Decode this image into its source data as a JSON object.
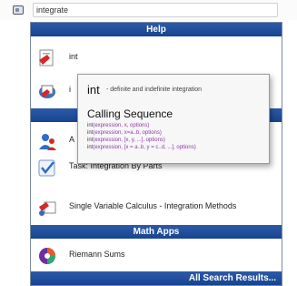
{
  "search": {
    "value": "integrate"
  },
  "sections": {
    "help": "Help",
    "math_apps": "Math Apps"
  },
  "results": [
    {
      "label": "int",
      "icon": "help-page-icon"
    },
    {
      "label": "i",
      "icon": "help-page-icon"
    },
    {
      "label": "A",
      "icon": "users-icon"
    },
    {
      "label": "Task: Integration By Parts",
      "icon": "checkmark-icon"
    },
    {
      "label": "Single Variable Calculus - Integration Methods",
      "icon": "tutor-icon"
    },
    {
      "label": "Riemann Sums",
      "icon": "math-app-icon"
    }
  ],
  "tooltip": {
    "name": "int",
    "description": "- definite and indefinite integration",
    "heading": "Calling Sequence",
    "sequence": [
      {
        "fn": "int",
        "args": "(expression, x, options)"
      },
      {
        "fn": "int",
        "args": "(expression, x=a..b, options)"
      },
      {
        "fn": "int",
        "args": "(expression, [x, y, ...], options)"
      },
      {
        "fn": "int",
        "args": "(expression, [x = a..b, y = c..d, ...], options)"
      }
    ]
  },
  "footer": {
    "link": "All Search Results..."
  },
  "colors": {
    "header_bg": "#16458f",
    "header_text": "#ffffff",
    "args": "#8b3aa8"
  }
}
